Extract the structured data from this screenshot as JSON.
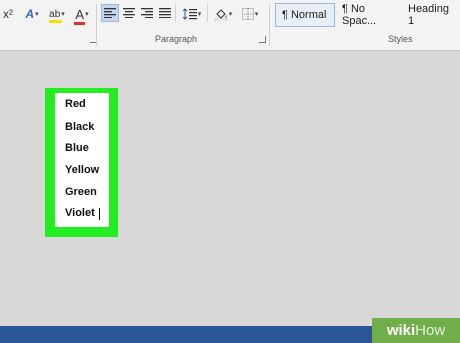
{
  "ribbon": {
    "superscript_label": "x²",
    "paragraph_label": "Paragraph",
    "styles_label": "Styles",
    "styles": [
      {
        "label": "¶ Normal",
        "selected": true
      },
      {
        "label": "¶ No Spac..."
      },
      {
        "label": "Heading 1"
      }
    ],
    "font_color": "#e03030",
    "highlight_color": "#f5e000"
  },
  "document": {
    "words": [
      "Red",
      "Black",
      "Blue",
      "Yellow",
      "Green",
      "Violet"
    ],
    "border_color": "#22ee22"
  },
  "watermark": {
    "wiki": "wiki",
    "how": "How"
  }
}
